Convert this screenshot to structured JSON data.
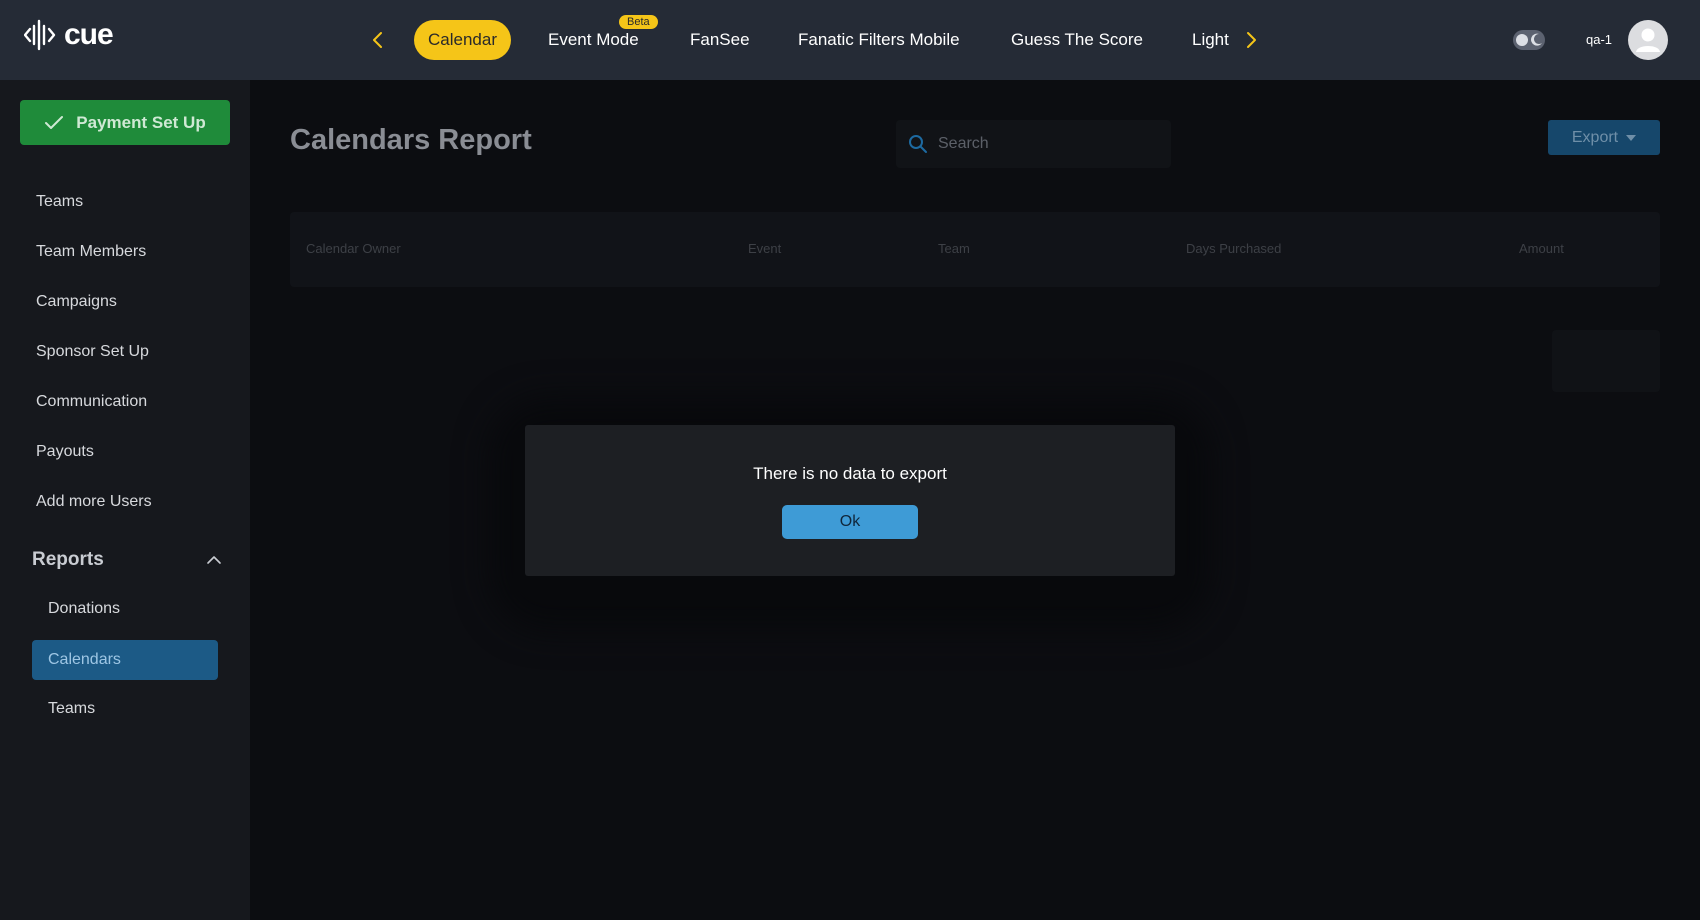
{
  "app": {
    "logo_text": "cue"
  },
  "colors": {
    "topbar": "#252b36",
    "accent_yellow": "#f5c518",
    "sidebar": "#16181d",
    "payment_green": "#1f8b3a",
    "active_blue": "#1c5a86",
    "ok_button": "#3e9bd6"
  },
  "topnav": {
    "tabs": [
      {
        "label": "Calendar",
        "active": true
      },
      {
        "label": "Event Mode",
        "badge": "Beta"
      },
      {
        "label": "FanSee"
      },
      {
        "label": "Fanatic Filters Mobile"
      },
      {
        "label": "Guess The Score"
      },
      {
        "label": "Light"
      }
    ],
    "prev_icon": "chevron-left-icon",
    "next_icon": "chevron-right-icon"
  },
  "header": {
    "username": "qa-1",
    "theme_toggle_icon": "theme-toggle-icon",
    "avatar_icon": "user-icon"
  },
  "sidebar": {
    "payment_button": "Payment Set Up",
    "items": [
      "Teams",
      "Team Members",
      "Campaigns",
      "Sponsor Set Up",
      "Communication",
      "Payouts",
      "Add more Users"
    ],
    "reports": {
      "label": "Reports",
      "expanded": true,
      "items": [
        "Donations",
        "Calendars",
        "Teams"
      ],
      "active": "Calendars"
    }
  },
  "main": {
    "title": "Calendars Report",
    "search_placeholder": "Search",
    "export_label": "Export",
    "columns": [
      "Calendar Owner",
      "Event",
      "Team",
      "Days Purchased",
      "Amount"
    ]
  },
  "modal": {
    "message": "There is no data to export",
    "ok_label": "Ok"
  }
}
